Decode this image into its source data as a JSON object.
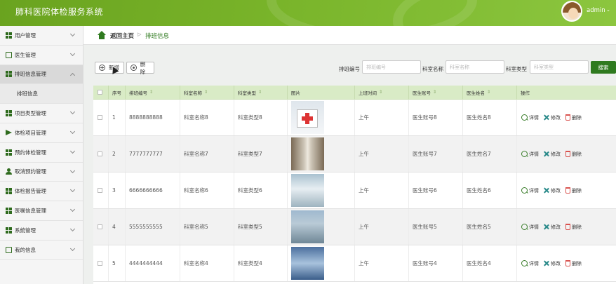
{
  "app": {
    "title": "肺科医院体检服务系统",
    "user": "admin"
  },
  "sidebar": {
    "items": [
      {
        "label": "用户管理",
        "icon": "grid-icon"
      },
      {
        "label": "医生管理",
        "icon": "doc-icon"
      },
      {
        "label": "排班信息管理",
        "icon": "grid-icon"
      },
      {
        "label": "排班信息",
        "icon": ""
      },
      {
        "label": "项目类型管理",
        "icon": "grid-icon"
      },
      {
        "label": "体检项目管理",
        "icon": "plane-icon"
      },
      {
        "label": "预约体检管理",
        "icon": "grid-icon"
      },
      {
        "label": "取消预约管理",
        "icon": "person-icon"
      },
      {
        "label": "体检报告管理",
        "icon": "grid-icon"
      },
      {
        "label": "医嘱信息管理",
        "icon": "grid-icon"
      },
      {
        "label": "系统管理",
        "icon": "grid-icon"
      },
      {
        "label": "我的信息",
        "icon": "doc-icon"
      }
    ]
  },
  "breadcrumb": {
    "home": "返回主页",
    "current": "排班信息"
  },
  "toolbar": {
    "add": "新增",
    "delete": "删除",
    "search": "搜索"
  },
  "filters": [
    {
      "label": "排班编号",
      "placeholder": "排班编号"
    },
    {
      "label": "科室名称",
      "placeholder": "科室名称"
    },
    {
      "label": "科室类型",
      "placeholder": "科室类型"
    }
  ],
  "table": {
    "columns": [
      "序号",
      "排班编号",
      "科室名称",
      "科室类型",
      "图片",
      "上班时间",
      "医生账号",
      "医生姓名",
      "操作"
    ],
    "actions": {
      "detail": "详情",
      "edit": "修改",
      "delete": "删除"
    },
    "rows": [
      {
        "idx": "1",
        "code": "8888888888",
        "dept": "科室名称8",
        "type": "科室类型8",
        "time": "上午",
        "account": "医生账号8",
        "doctor": "医生姓名8"
      },
      {
        "idx": "2",
        "code": "7777777777",
        "dept": "科室名称7",
        "type": "科室类型7",
        "time": "上午",
        "account": "医生账号7",
        "doctor": "医生姓名7"
      },
      {
        "idx": "3",
        "code": "6666666666",
        "dept": "科室名称6",
        "type": "科室类型6",
        "time": "上午",
        "account": "医生账号6",
        "doctor": "医生姓名6"
      },
      {
        "idx": "4",
        "code": "5555555555",
        "dept": "科室名称5",
        "type": "科室类型5",
        "time": "上午",
        "account": "医生账号5",
        "doctor": "医生姓名5"
      },
      {
        "idx": "5",
        "code": "4444444444",
        "dept": "科室名称4",
        "type": "科室类型4",
        "time": "上午",
        "account": "医生账号4",
        "doctor": "医生姓名4"
      }
    ]
  },
  "colors": {
    "brand": "#2f7a1f",
    "header": "#79b42a",
    "table_head": "#d9ebc6"
  }
}
